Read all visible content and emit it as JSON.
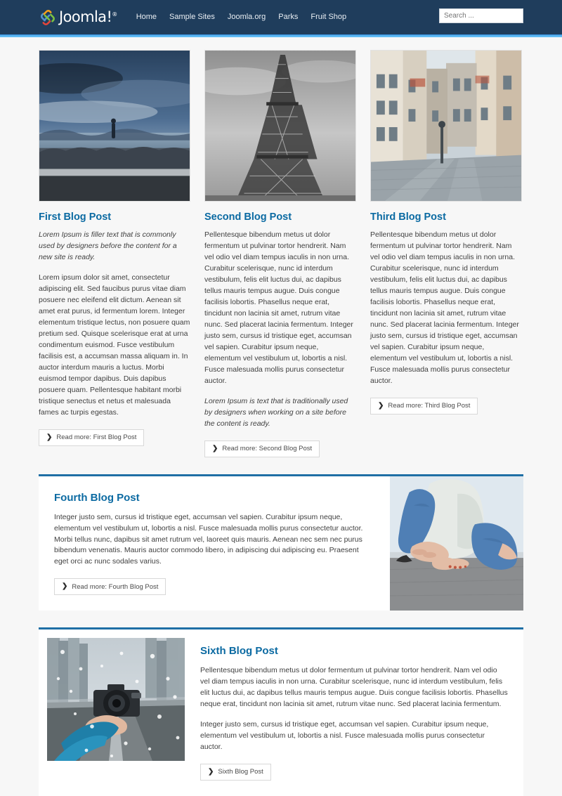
{
  "header": {
    "brand_name": "Joomla!",
    "brand_reg": "®",
    "logo_icon": "joomla-logo-icon",
    "nav": [
      {
        "label": "Home",
        "name": "nav-item-home"
      },
      {
        "label": "Sample Sites",
        "name": "nav-item-sample-sites"
      },
      {
        "label": "Joomla.org",
        "name": "nav-item-joomla-org"
      },
      {
        "label": "Parks",
        "name": "nav-item-parks"
      },
      {
        "label": "Fruit Shop",
        "name": "nav-item-fruit-shop"
      }
    ],
    "search": {
      "placeholder": "Search ...",
      "value": ""
    },
    "colors": {
      "header_bg": "#1f3d5c",
      "accent_bar": "#4aa3e8",
      "link_blue": "#0b6aa2",
      "card_top_border": "#1f6fa5",
      "page_bg": "#f7f7f7"
    }
  },
  "columns": [
    {
      "title": "First Blog Post",
      "image_alt": "person-standing-on-rocks-by-the-sea",
      "intro": "Lorem Ipsum is filler text that is commonly used by designers before the content for a new site is ready.",
      "body": "Lorem ipsum dolor sit amet, consectetur adipiscing elit. Sed faucibus purus vitae diam posuere nec eleifend elit dictum. Aenean sit amet erat purus, id fermentum lorem. Integer elementum tristique lectus, non posuere quam pretium sed. Quisque scelerisque erat at urna condimentum euismod. Fusce vestibulum facilisis est, a accumsan massa aliquam in. In auctor interdum mauris a luctus. Morbi euismod tempor dapibus. Duis dapibus posuere quam. Pellentesque habitant morbi tristique senectus et netus et malesuada fames ac turpis egestas.",
      "readmore": "Read more: First Blog Post"
    },
    {
      "title": "Second Blog Post",
      "image_alt": "eiffel-tower-black-and-white",
      "body": "Pellentesque bibendum metus ut dolor fermentum ut pulvinar tortor hendrerit. Nam vel odio vel diam tempus iaculis in non urna. Curabitur scelerisque, nunc id interdum vestibulum, felis elit luctus dui, ac dapibus tellus mauris tempus augue. Duis congue facilisis lobortis. Phasellus neque erat, tincidunt non lacinia sit amet, rutrum vitae nunc. Sed placerat lacinia fermentum. Integer justo sem, cursus id tristique eget, accumsan vel sapien. Curabitur ipsum neque, elementum vel vestibulum ut, lobortis a nisl. Fusce malesuada mollis purus consectetur auctor.",
      "intro_after": "Lorem Ipsum is text that is traditionally used by designers when working on a site before the content is ready.",
      "readmore": "Read more: Second Blog Post"
    },
    {
      "title": "Third Blog Post",
      "image_alt": "narrow-european-cobblestone-street",
      "body": "Pellentesque bibendum metus ut dolor fermentum ut pulvinar tortor hendrerit. Nam vel odio vel diam tempus iaculis in non urna. Curabitur scelerisque, nunc id interdum vestibulum, felis elit luctus dui, ac dapibus tellus mauris tempus augue. Duis congue facilisis lobortis. Phasellus neque erat, tincidunt non lacinia sit amet, rutrum vitae nunc. Sed placerat lacinia fermentum. Integer justo sem, cursus id tristique eget, accumsan vel sapien. Curabitur ipsum neque, elementum vel vestibulum ut, lobortis a nisl. Fusce malesuada mollis purus consectetur auctor.",
      "readmore": "Read more: Third Blog Post"
    }
  ],
  "fourth": {
    "title": "Fourth Blog Post",
    "image_alt": "person-sitting-on-floor-barefoot-in-jeans",
    "body": "Integer justo sem, cursus id tristique eget, accumsan vel sapien. Curabitur ipsum neque, elementum vel vestibulum ut, lobortis a nisl. Fusce malesuada mollis purus consectetur auctor. Morbi tellus nunc, dapibus sit amet rutrum vel, laoreet quis mauris. Aenean nec sem nec purus bibendum venenatis. Mauris auctor commodo libero, in adipiscing dui adipiscing eu. Praesent eget orci ac nunc sodales varius.",
    "readmore": "Read more: Fourth Blog Post"
  },
  "sixth": {
    "title": "Sixth Blog Post",
    "image_alt": "hand-holding-camera-on-snowy-road",
    "body_1": "Pellentesque bibendum metus ut dolor fermentum ut pulvinar tortor hendrerit. Nam vel odio vel diam tempus iaculis in non urna. Curabitur scelerisque, nunc id interdum vestibulum, felis elit luctus dui, ac dapibus tellus mauris tempus augue. Duis congue facilisis lobortis. Phasellus neque erat, tincidunt non lacinia sit amet, rutrum vitae nunc. Sed placerat lacinia fermentum.",
    "body_2": "Integer justo sem, cursus id tristique eget, accumsan vel sapien. Curabitur ipsum neque, elementum vel vestibulum ut, lobortis a nisl. Fusce malesuada mollis purus consectetur auctor.",
    "readmore": "Sixth Blog Post"
  },
  "icons": {
    "chevron": "❯"
  }
}
